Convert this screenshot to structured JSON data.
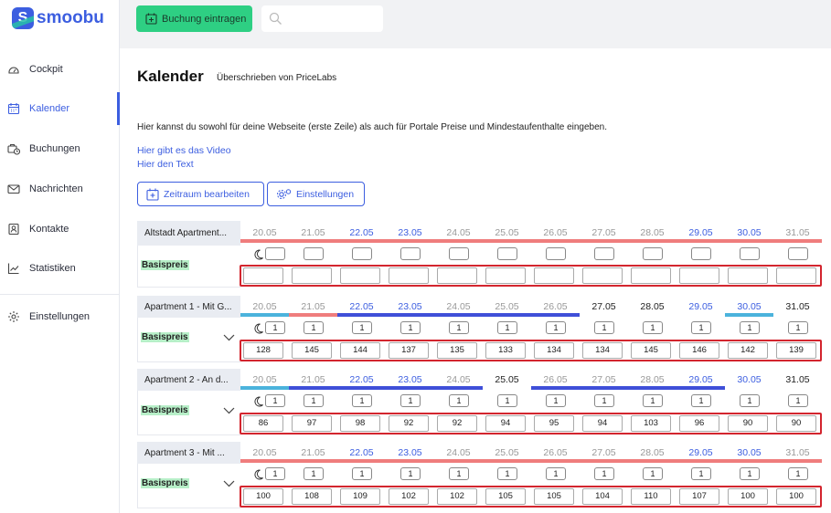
{
  "app": {
    "name": "smoobu",
    "logo_letter": "S"
  },
  "nav": {
    "items": [
      {
        "label": "Cockpit",
        "icon": "cockpit-icon",
        "active": false
      },
      {
        "label": "Kalender",
        "icon": "calendar-icon",
        "active": true
      },
      {
        "label": "Buchungen",
        "icon": "bookings-icon",
        "active": false
      },
      {
        "label": "Nachrichten",
        "icon": "mail-icon",
        "active": false
      },
      {
        "label": "Kontakte",
        "icon": "contacts-icon",
        "active": false
      },
      {
        "label": "Statistiken",
        "icon": "chart-icon",
        "active": false
      }
    ],
    "settings": {
      "label": "Einstellungen",
      "icon": "gear-icon"
    }
  },
  "topbar": {
    "new_booking": "Buchung eintragen",
    "search_placeholder": ""
  },
  "page": {
    "title": "Kalender",
    "subtitle": "Überschrieben von PriceLabs",
    "description": "Hier kannst du sowohl für deine Webseite (erste Zeile) als auch für Portale Preise und Mindestaufenthalte eingeben.",
    "link_video": "Hier gibt es das Video",
    "link_text": "Hier den Text",
    "btn_edit_period": "Zeitraum bearbeiten",
    "btn_settings": "Einstellungen"
  },
  "colors": {
    "accent": "#3c5ee0",
    "green": "#2ecf83",
    "booking_red": "#ef7d7d",
    "booking_blue": "#3f4fd8",
    "booking_cyan": "#4bb3dc",
    "frame_red": "#d3252e"
  },
  "calendar": {
    "dates": [
      "20.05",
      "21.05",
      "22.05",
      "23.05",
      "24.05",
      "25.05",
      "26.05",
      "27.05",
      "28.05",
      "29.05",
      "30.05",
      "31.05"
    ],
    "rows": [
      {
        "name": "Altstadt Apartment...",
        "label": "Basispreis",
        "has_dropdown": false,
        "date_styles": [
          "g",
          "g",
          "b",
          "b",
          "g",
          "g",
          "g",
          "g",
          "g",
          "b",
          "b",
          "g"
        ],
        "bars": [
          {
            "from": 0,
            "to": 12,
            "color": "red"
          }
        ],
        "min_stay": [
          "",
          "",
          "",
          "",
          "",
          "",
          "",
          "",
          "",
          "",
          "",
          ""
        ],
        "prices": [
          "",
          "",
          "",
          "",
          "",
          "",
          "",
          "",
          "",
          "",
          "",
          ""
        ]
      },
      {
        "name": "Apartment 1 - Mit G...",
        "label": "Basispreis",
        "has_dropdown": true,
        "date_styles": [
          "g",
          "g",
          "b",
          "b",
          "g",
          "g",
          "g",
          "d",
          "d",
          "b",
          "b",
          "d"
        ],
        "bars": [
          {
            "from": 0,
            "to": 1,
            "color": "cyan"
          },
          {
            "from": 1,
            "to": 2,
            "color": "red"
          },
          {
            "from": 2,
            "to": 7,
            "color": "blue"
          },
          {
            "from": 10,
            "to": 11,
            "color": "cyan"
          }
        ],
        "min_stay": [
          "1",
          "1",
          "1",
          "1",
          "1",
          "1",
          "1",
          "1",
          "1",
          "1",
          "1",
          "1"
        ],
        "prices": [
          "128",
          "145",
          "144",
          "137",
          "135",
          "133",
          "134",
          "134",
          "145",
          "146",
          "142",
          "139"
        ]
      },
      {
        "name": "Apartment 2 - An d...",
        "label": "Basispreis",
        "has_dropdown": true,
        "date_styles": [
          "g",
          "g",
          "b",
          "b",
          "g",
          "d",
          "g",
          "g",
          "g",
          "b",
          "b",
          "d"
        ],
        "bars": [
          {
            "from": 0,
            "to": 1,
            "color": "cyan"
          },
          {
            "from": 1,
            "to": 5,
            "color": "blue"
          },
          {
            "from": 6,
            "to": 10,
            "color": "blue"
          }
        ],
        "min_stay": [
          "1",
          "1",
          "1",
          "1",
          "1",
          "1",
          "1",
          "1",
          "1",
          "1",
          "1",
          "1"
        ],
        "prices": [
          "86",
          "97",
          "98",
          "92",
          "92",
          "94",
          "95",
          "94",
          "103",
          "96",
          "90",
          "90"
        ]
      },
      {
        "name": "Apartment 3 - Mit ...",
        "label": "Basispreis",
        "has_dropdown": true,
        "date_styles": [
          "g",
          "g",
          "b",
          "b",
          "g",
          "g",
          "g",
          "g",
          "g",
          "b",
          "b",
          "g"
        ],
        "bars": [
          {
            "from": 0,
            "to": 12,
            "color": "red"
          }
        ],
        "min_stay": [
          "1",
          "1",
          "1",
          "1",
          "1",
          "1",
          "1",
          "1",
          "1",
          "1",
          "1",
          "1"
        ],
        "prices": [
          "100",
          "108",
          "109",
          "102",
          "102",
          "105",
          "105",
          "104",
          "110",
          "107",
          "100",
          "100"
        ]
      }
    ]
  }
}
